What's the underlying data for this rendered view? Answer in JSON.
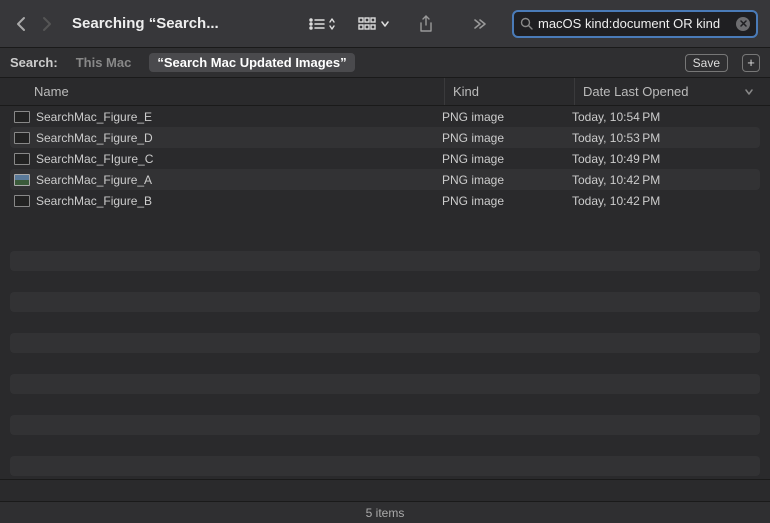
{
  "toolbar": {
    "title": "Searching “Search...",
    "search_value": "macOS kind:document OR kind"
  },
  "scope": {
    "label": "Search:",
    "options": [
      "This Mac",
      "“Search Mac Updated Images”"
    ],
    "active_index": 1,
    "save_label": "Save"
  },
  "columns": {
    "name": "Name",
    "kind": "Kind",
    "date": "Date Last Opened"
  },
  "files": [
    {
      "name": "SearchMac_Figure_E",
      "kind": "PNG image",
      "date": "Today, 10:54 PM",
      "thumb": false
    },
    {
      "name": "SearchMac_Figure_D",
      "kind": "PNG image",
      "date": "Today, 10:53 PM",
      "thumb": false
    },
    {
      "name": "SearchMac_FIgure_C",
      "kind": "PNG image",
      "date": "Today, 10:49 PM",
      "thumb": false
    },
    {
      "name": "SearchMac_Figure_A",
      "kind": "PNG image",
      "date": "Today, 10:42 PM",
      "thumb": true
    },
    {
      "name": "SearchMac_Figure_B",
      "kind": "PNG image",
      "date": "Today, 10:42 PM",
      "thumb": false
    }
  ],
  "status": "5 items"
}
